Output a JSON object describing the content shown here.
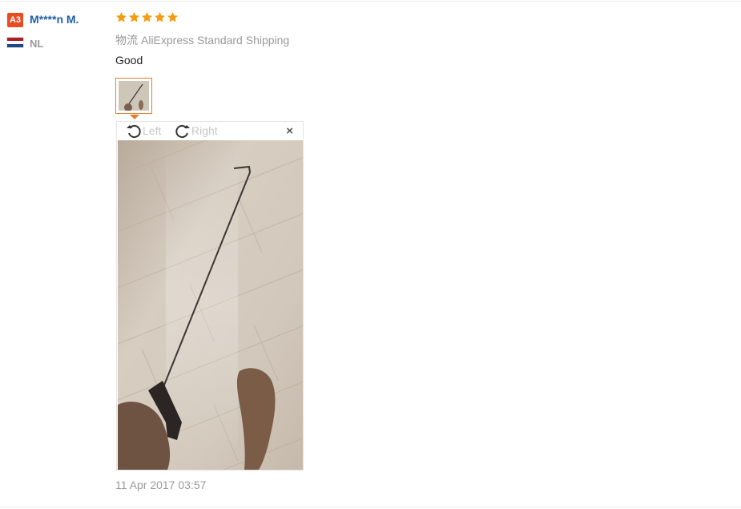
{
  "review": {
    "user": {
      "level_badge": "A3",
      "name": "M****n M.",
      "country": "NL"
    },
    "rating": 5,
    "shipping": {
      "label_cn": "物流",
      "method": "AliExpress Standard Shipping"
    },
    "text": "Good",
    "date": "11 Apr 2017 03:57"
  },
  "viewer": {
    "rotate_left_label": "Left",
    "rotate_right_label": "Right",
    "close_label": "×"
  },
  "colors": {
    "badge": "#e84d22",
    "username": "#1f5fa8",
    "star": "#f39c12",
    "thumb_border": "#e97b2c",
    "flag": [
      "#ae1c28",
      "#ffffff",
      "#21468b"
    ]
  },
  "icons": {
    "star": "star-icon",
    "rotate_left": "rotate-left-icon",
    "rotate_right": "rotate-right-icon",
    "close": "close-icon"
  }
}
